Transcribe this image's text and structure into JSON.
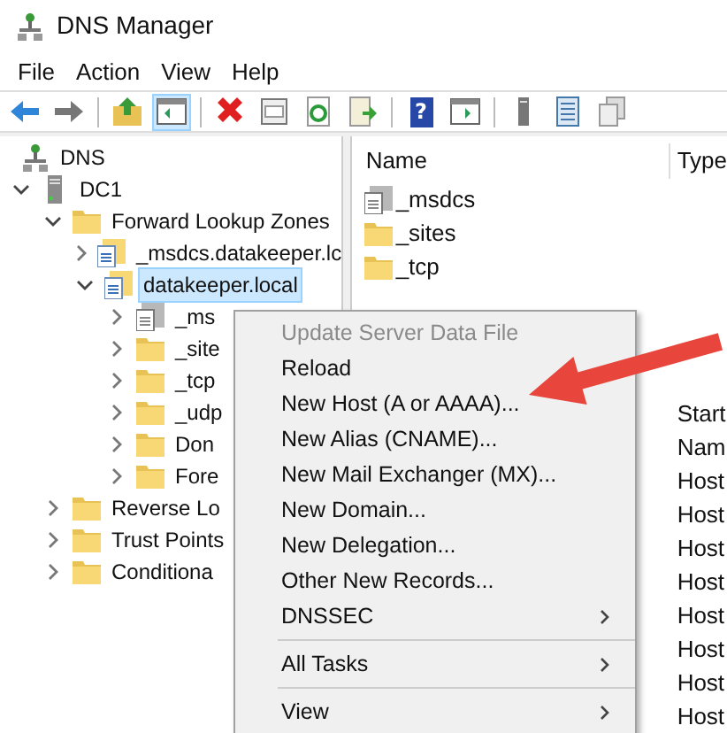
{
  "window": {
    "title": "DNS Manager"
  },
  "menu_bar": [
    "File",
    "Action",
    "View",
    "Help"
  ],
  "toolbar": [
    {
      "kind": "back",
      "selected": false
    },
    {
      "kind": "forward",
      "selected": false
    },
    {
      "kind": "separator"
    },
    {
      "kind": "up",
      "selected": false
    },
    {
      "kind": "console",
      "selected": true
    },
    {
      "kind": "separator"
    },
    {
      "kind": "delete",
      "selected": false
    },
    {
      "kind": "properties",
      "selected": false
    },
    {
      "kind": "refresh",
      "selected": false
    },
    {
      "kind": "export",
      "selected": false
    },
    {
      "kind": "separator"
    },
    {
      "kind": "help",
      "selected": false,
      "label": "?"
    },
    {
      "kind": "actionpane",
      "selected": false
    },
    {
      "kind": "separator"
    },
    {
      "kind": "server",
      "selected": false
    },
    {
      "kind": "list",
      "selected": false
    },
    {
      "kind": "copy",
      "selected": false
    }
  ],
  "tree": [
    {
      "label": "DNS",
      "kind": "dns",
      "selected": false,
      "children": [
        {
          "label": "DC1",
          "kind": "server",
          "expanded": true,
          "selected": false,
          "children": [
            {
              "label": "Forward Lookup Zones",
              "kind": "folder",
              "expanded": true,
              "selected": false,
              "children": [
                {
                  "label": "_msdcs.datakeeper.lc",
                  "kind": "zone",
                  "expanded": false,
                  "selected": false
                },
                {
                  "label": "datakeeper.local",
                  "kind": "zone",
                  "expanded": true,
                  "selected": true,
                  "children": [
                    {
                      "label": "_ms",
                      "kind": "zone_gray",
                      "expanded": false,
                      "selected": false
                    },
                    {
                      "label": "_site",
                      "kind": "folder",
                      "expanded": false,
                      "selected": false
                    },
                    {
                      "label": "_tcp",
                      "kind": "folder",
                      "expanded": false,
                      "selected": false
                    },
                    {
                      "label": "_udp",
                      "kind": "folder",
                      "expanded": false,
                      "selected": false
                    },
                    {
                      "label": "Don",
                      "kind": "folder",
                      "expanded": false,
                      "selected": false
                    },
                    {
                      "label": "Fore",
                      "kind": "folder",
                      "expanded": false,
                      "selected": false
                    }
                  ]
                }
              ]
            },
            {
              "label": "Reverse Lo",
              "kind": "folder",
              "expanded": false,
              "selected": false
            },
            {
              "label": "Trust Points",
              "kind": "folder",
              "expanded": false,
              "selected": false
            },
            {
              "label": "Conditiona",
              "kind": "folder",
              "expanded": false,
              "selected": false
            }
          ]
        }
      ]
    }
  ],
  "details": {
    "columns": [
      "Name",
      "Type"
    ],
    "rows": [
      {
        "name": "_msdcs",
        "kind": "zone_gray"
      },
      {
        "name": "_sites",
        "kind": "folder"
      },
      {
        "name": "_tcp",
        "kind": "folder"
      }
    ],
    "type_cells": [
      "Start",
      "Nam",
      "Host",
      "Host",
      "Host",
      "Host",
      "Host",
      "Host",
      "Host",
      "Host"
    ]
  },
  "context_menu": [
    {
      "kind": "item",
      "label": "Update Server Data File",
      "disabled": true,
      "submenu": false
    },
    {
      "kind": "item",
      "label": "Reload",
      "disabled": false,
      "submenu": false
    },
    {
      "kind": "item",
      "label": "New Host (A or AAAA)...",
      "disabled": false,
      "submenu": false
    },
    {
      "kind": "item",
      "label": "New Alias (CNAME)...",
      "disabled": false,
      "submenu": false
    },
    {
      "kind": "item",
      "label": "New Mail Exchanger (MX)...",
      "disabled": false,
      "submenu": false
    },
    {
      "kind": "item",
      "label": "New Domain...",
      "disabled": false,
      "submenu": false
    },
    {
      "kind": "item",
      "label": "New Delegation...",
      "disabled": false,
      "submenu": false
    },
    {
      "kind": "item",
      "label": "Other New Records...",
      "disabled": false,
      "submenu": false
    },
    {
      "kind": "item",
      "label": "DNSSEC",
      "disabled": false,
      "submenu": true
    },
    {
      "kind": "separator"
    },
    {
      "kind": "item",
      "label": "All Tasks",
      "disabled": false,
      "submenu": true
    },
    {
      "kind": "separator"
    },
    {
      "kind": "item",
      "label": "View",
      "disabled": false,
      "submenu": true
    }
  ]
}
